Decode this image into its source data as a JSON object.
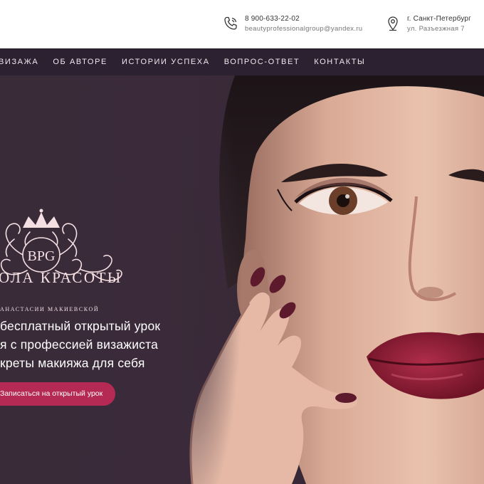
{
  "header": {
    "phone": "8 900-633-22-02",
    "email": "beautyprofessionalgroup@yandex.ru",
    "city": "г. Санкт-Петербург",
    "street": "ул. Разъезжная 7"
  },
  "nav": {
    "items": [
      "ВИЗАЖА",
      "ОБ АВТОРЕ",
      "ИСТОРИИ УСПЕХА",
      "ВОПРОС-ОТВЕТ",
      "КОНТАКТЫ"
    ]
  },
  "hero": {
    "logo_monogram": "BPG",
    "brand_title": "ОЛА КРАСОТЫ",
    "brand_subtitle": "АНАСТАСИИ МАКИЕВСКОЙ",
    "line1": "бесплатный открытый урок",
    "line2": "я с профессией визажиста",
    "line3": "креты макияжа для себя",
    "cta_label": "Записаться на открытый урок"
  },
  "colors": {
    "nav_bg": "#2c2130",
    "hero_bg": "#3a2b39",
    "accent": "#b52a55",
    "logo": "#f4dfe3"
  },
  "icons": {
    "phone": "phone-icon",
    "location": "map-pin-icon",
    "logo": "crown-monogram-logo"
  }
}
